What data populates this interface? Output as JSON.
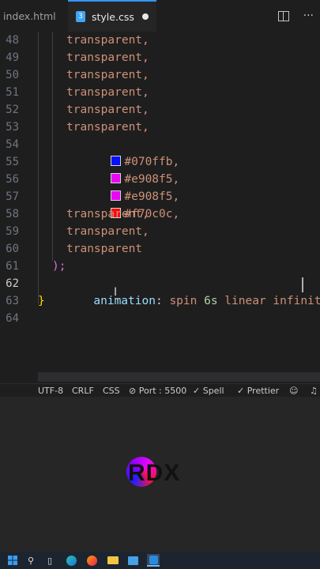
{
  "tabs": [
    {
      "label": "index.html"
    },
    {
      "label": "style.css",
      "icon": "css3-icon",
      "modified": true
    }
  ],
  "editor": {
    "lines": [
      {
        "n": "48",
        "text": "transparent,"
      },
      {
        "n": "49",
        "text": "transparent,"
      },
      {
        "n": "50",
        "text": "transparent,"
      },
      {
        "n": "51",
        "text": "transparent,"
      },
      {
        "n": "52",
        "text": "transparent,"
      },
      {
        "n": "53",
        "text": "transparent,"
      },
      {
        "n": "54",
        "text": "#070ffb,",
        "swatch": "#070ffb"
      },
      {
        "n": "55",
        "text": "#e908f5,",
        "swatch": "#e908f5"
      },
      {
        "n": "56",
        "text": "#e908f5,",
        "swatch": "#e908f5"
      },
      {
        "n": "57",
        "text": "#f70c0c,",
        "swatch": "#f70c0c"
      },
      {
        "n": "58",
        "text": "transparent,"
      },
      {
        "n": "59",
        "text": "transparent,"
      },
      {
        "n": "60",
        "text": "transparent"
      },
      {
        "n": "61",
        "text": ");"
      },
      {
        "n": "62",
        "prop": "animation",
        "colon": ":",
        "v1": "spin",
        "v2": "6s",
        "v3": "linear infinite;"
      },
      {
        "n": "63",
        "text": "}"
      },
      {
        "n": "64",
        "text": ""
      }
    ]
  },
  "statusbar": {
    "encoding": "UTF-8",
    "eol": "CRLF",
    "language": "CSS",
    "port": "Port : 5500",
    "spell": "Spell",
    "prettier": "Prettier"
  },
  "overlay": {
    "logo_text": "RDX"
  }
}
